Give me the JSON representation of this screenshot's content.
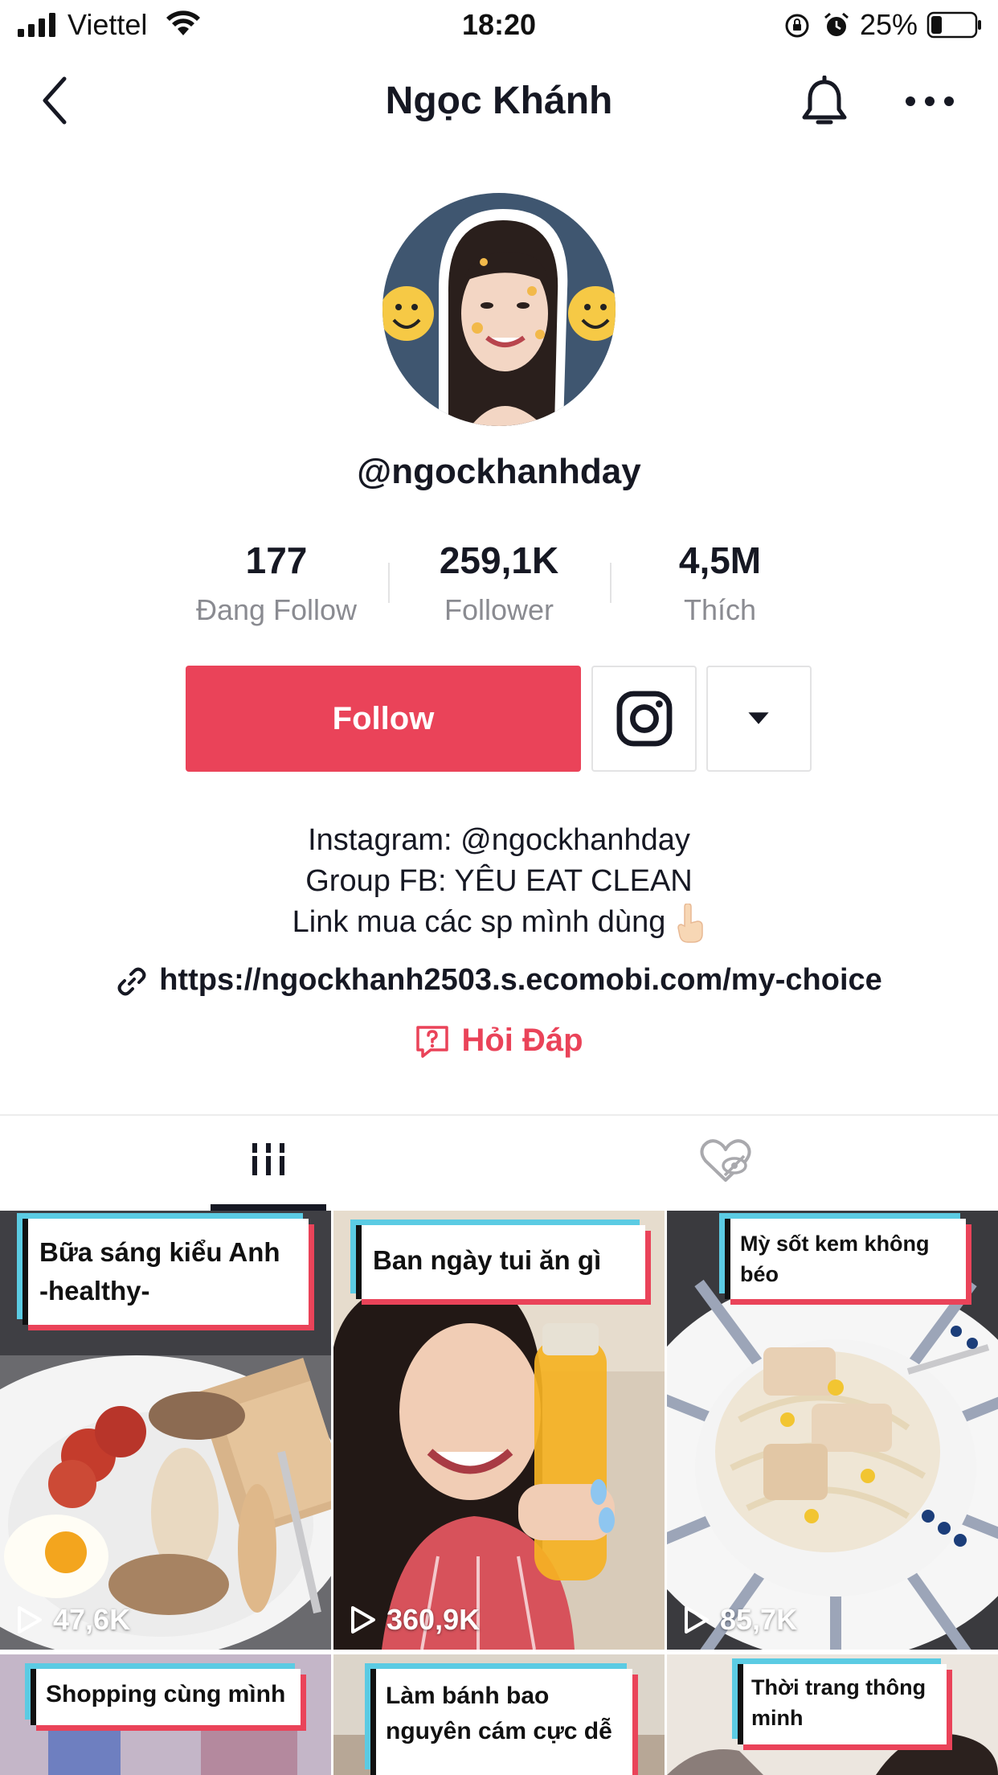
{
  "status_bar": {
    "carrier": "Viettel",
    "time": "18:20",
    "battery_percent": "25%",
    "battery_level": 0.25
  },
  "nav": {
    "title": "Ngọc Khánh",
    "back_icon": "chevron-left-icon",
    "bell_icon": "bell-icon",
    "more_icon": "more-horizontal-icon"
  },
  "profile": {
    "username": "@ngockhanhday",
    "stats": [
      {
        "value": "177",
        "label": "Đang Follow"
      },
      {
        "value": "259,1K",
        "label": "Follower"
      },
      {
        "value": "4,5M",
        "label": "Thích"
      }
    ],
    "follow_label": "Follow",
    "bio_lines": [
      "Instagram: @ngockhanhday",
      "Group FB: YÊU EAT CLEAN",
      "Link mua các sp mình dùng"
    ],
    "link": "https://ngockhanh2503.s.ecomobi.com/my-choice",
    "qa_label": "Hỏi Đáp"
  },
  "colors": {
    "accent": "#ea4359",
    "text": "#161823",
    "muted": "#8a8b91"
  },
  "videos": [
    {
      "title": "Bữa sáng kiểu Anh -healthy-",
      "title_lines": [
        "Bữa sáng kiểu Anh",
        "-healthy-"
      ],
      "views": "47,6K"
    },
    {
      "title": "Ban ngày tui ăn gì",
      "title_lines": [
        "Ban ngày tui ăn gì"
      ],
      "views": "360,9K"
    },
    {
      "title": "Mỳ sốt kem không béo",
      "title_lines": [
        "Mỳ sốt kem không",
        "béo"
      ],
      "views": "85,7K"
    },
    {
      "title": "Shopping cùng mình",
      "title_lines": [
        "Shopping cùng mình"
      ],
      "views": ""
    },
    {
      "title": "Làm bánh bao nguyên cám cực dễ",
      "title_lines": [
        "Làm bánh bao",
        "nguyên cám cực dễ"
      ],
      "views": ""
    },
    {
      "title": "Thời trang thông minh",
      "title_lines": [
        "Thời trang thông",
        "minh"
      ],
      "views": ""
    }
  ]
}
